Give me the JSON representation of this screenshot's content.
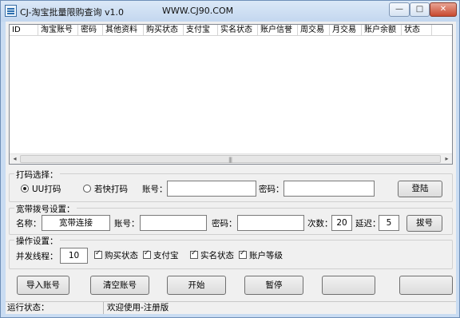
{
  "window": {
    "title": "CJ-淘宝批量限购查询 v1.0",
    "url_label": "WWW.CJ90.COM",
    "controls": {
      "minimize": "—",
      "maximize": "□",
      "close": "✕"
    }
  },
  "listview": {
    "columns": [
      "ID",
      "淘宝账号",
      "密码",
      "其他资料",
      "购买状态",
      "支付宝",
      "实名状态",
      "账户信誉",
      "周交易",
      "月交易",
      "账户余额",
      "状态"
    ],
    "rows": [],
    "scroll": {
      "left_arrow": "◂",
      "right_arrow": "▸",
      "grip": "|||"
    }
  },
  "captcha": {
    "title": "打码选择：",
    "option1": "UU打码",
    "option2": "若快打码",
    "selected": "UU打码",
    "account_label": "账号：",
    "account_value": "",
    "password_label": "密码：",
    "password_value": "",
    "login_button": "登陆"
  },
  "broadband": {
    "title": "宽带拨号设置：",
    "name_label": "名称：",
    "name_value": "宽带连接",
    "account_label": "账号：",
    "account_value": "",
    "password_label": "密码：",
    "password_value": "",
    "count_label": "次数：",
    "count_value": "20",
    "delay_label": "延迟：",
    "delay_value": "5",
    "dial_button": "拔号"
  },
  "operation": {
    "title": "操作设置：",
    "threads_label": "并发线程：",
    "threads_value": "10",
    "checks": [
      {
        "label": "购买状态",
        "checked": true
      },
      {
        "label": "支付宝",
        "checked": true
      },
      {
        "label": "实名状态",
        "checked": true
      },
      {
        "label": "账户等级",
        "checked": true
      }
    ]
  },
  "actions": {
    "import": "导入账号",
    "clear": "清空账号",
    "start": "开始",
    "pause": "暂停",
    "extra1": "",
    "extra2": ""
  },
  "statusbar": {
    "label": "运行状态：",
    "message": "欢迎使用-注册版"
  }
}
